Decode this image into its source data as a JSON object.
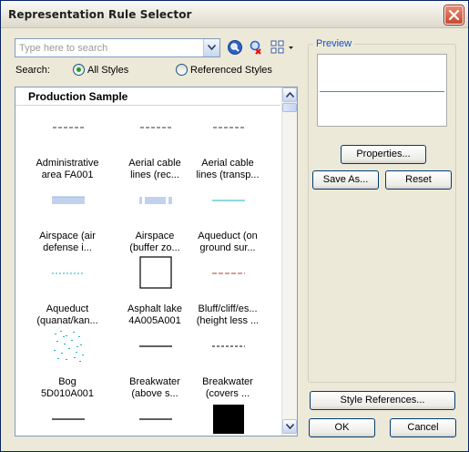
{
  "window": {
    "title": "Representation Rule Selector"
  },
  "search": {
    "placeholder": "Type here to search",
    "label": "Search:"
  },
  "scope": {
    "all_styles": "All Styles",
    "referenced_styles": "Referenced Styles",
    "selected": "All Styles"
  },
  "list": {
    "header": "Production Sample",
    "items": [
      {
        "label": "Administrative\narea FA001",
        "swatch": "dash-line-dark"
      },
      {
        "label": "Aerial cable\nlines (rec...",
        "swatch": "dash-line-dark"
      },
      {
        "label": "Aerial cable\nlines (transp...",
        "swatch": "dash-line-dark"
      },
      {
        "label": "Airspace (air\ndefense i...",
        "swatch": "blue-band"
      },
      {
        "label": "Airspace\n(buffer zo...",
        "swatch": "blue-band-notched"
      },
      {
        "label": "Aqueduct (on\nground sur...",
        "swatch": "cyan-line"
      },
      {
        "label": "Aqueduct\n(quanat/kan...",
        "swatch": "cyan-dashed-line"
      },
      {
        "label": "Asphalt lake\n4A005A001",
        "swatch": "outlined-square"
      },
      {
        "label": "Bluff/cliff/es...\n(height less ...",
        "swatch": "red-dash-line"
      },
      {
        "label": "Bog\n5D010A001",
        "swatch": "cyan-dotted-pattern"
      },
      {
        "label": "Breakwater\n(above s...",
        "swatch": "black-line"
      },
      {
        "label": "Breakwater\n(covers ...",
        "swatch": "black-dashed-line"
      },
      {
        "label": "",
        "swatch": "black-line"
      },
      {
        "label": "",
        "swatch": "black-line"
      },
      {
        "label": "",
        "swatch": "black-square"
      }
    ]
  },
  "preview": {
    "legend": "Preview",
    "line_color": "#1aa89b"
  },
  "buttons": {
    "properties": "Properties...",
    "save_as": "Save As...",
    "reset": "Reset",
    "style_references": "Style References...",
    "ok": "OK",
    "cancel": "Cancel"
  }
}
